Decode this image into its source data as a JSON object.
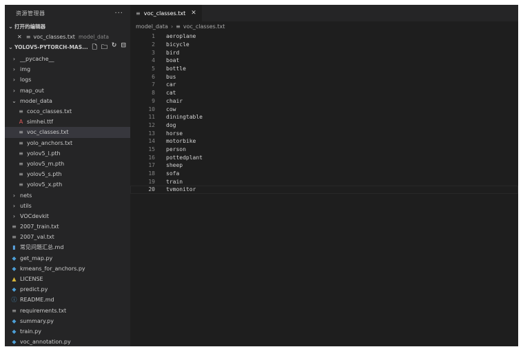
{
  "sidebar": {
    "title": "资源管理器",
    "more": "···",
    "open_editors": {
      "title": "打开的编辑器",
      "items": [
        {
          "name": "voc_classes.txt",
          "description": "model_data"
        }
      ]
    },
    "project": {
      "title": "YOLOV5-PYTORCH-MAS..."
    },
    "tree": [
      {
        "label": "__pycache__",
        "kind": "folder",
        "depth": 0,
        "expanded": false
      },
      {
        "label": "img",
        "kind": "folder",
        "depth": 0,
        "expanded": false
      },
      {
        "label": "logs",
        "kind": "folder",
        "depth": 0,
        "expanded": false
      },
      {
        "label": "map_out",
        "kind": "folder",
        "depth": 0,
        "expanded": false
      },
      {
        "label": "model_data",
        "kind": "folder",
        "depth": 0,
        "expanded": true
      },
      {
        "label": "coco_classes.txt",
        "kind": "txt",
        "depth": 1
      },
      {
        "label": "simhei.ttf",
        "kind": "ttf",
        "depth": 1
      },
      {
        "label": "voc_classes.txt",
        "kind": "txt",
        "depth": 1,
        "selected": true
      },
      {
        "label": "yolo_anchors.txt",
        "kind": "txt",
        "depth": 1
      },
      {
        "label": "yolov5_l.pth",
        "kind": "txt",
        "depth": 1
      },
      {
        "label": "yolov5_m.pth",
        "kind": "txt",
        "depth": 1
      },
      {
        "label": "yolov5_s.pth",
        "kind": "txt",
        "depth": 1
      },
      {
        "label": "yolov5_x.pth",
        "kind": "txt",
        "depth": 1
      },
      {
        "label": "nets",
        "kind": "folder",
        "depth": 0,
        "expanded": false
      },
      {
        "label": "utils",
        "kind": "folder",
        "depth": 0,
        "expanded": false
      },
      {
        "label": "VOCdevkit",
        "kind": "folder",
        "depth": 0,
        "expanded": false
      },
      {
        "label": "2007_train.txt",
        "kind": "txt",
        "depth": 0
      },
      {
        "label": "2007_val.txt",
        "kind": "txt",
        "depth": 0
      },
      {
        "label": "常见问题汇总.md",
        "kind": "md",
        "depth": 0
      },
      {
        "label": "get_map.py",
        "kind": "py",
        "depth": 0
      },
      {
        "label": "kmeans_for_anchors.py",
        "kind": "py",
        "depth": 0
      },
      {
        "label": "LICENSE",
        "kind": "lic",
        "depth": 0
      },
      {
        "label": "predict.py",
        "kind": "py",
        "depth": 0
      },
      {
        "label": "README.md",
        "kind": "info",
        "depth": 0
      },
      {
        "label": "requirements.txt",
        "kind": "txt",
        "depth": 0
      },
      {
        "label": "summary.py",
        "kind": "py",
        "depth": 0
      },
      {
        "label": "train.py",
        "kind": "py",
        "depth": 0
      },
      {
        "label": "voc_annotation.py",
        "kind": "py",
        "depth": 0
      }
    ]
  },
  "editor": {
    "tab": {
      "label": "voc_classes.txt",
      "close": "✕"
    },
    "breadcrumb": {
      "folder": "model_data",
      "separator": "›",
      "file": "voc_classes.txt"
    },
    "lines": [
      "aeroplane",
      "bicycle",
      "bird",
      "boat",
      "bottle",
      "bus",
      "car",
      "cat",
      "chair",
      "cow",
      "diningtable",
      "dog",
      "horse",
      "motorbike",
      "person",
      "pottedplant",
      "sheep",
      "sofa",
      "train",
      "tvmonitor"
    ],
    "active_line": 20
  },
  "icons": {
    "txt": "≡",
    "ttf": "A",
    "py": "◆",
    "md": "▮",
    "lic": "▲",
    "info": "ⓘ",
    "chevron_right": "›",
    "chevron_down": "⌄",
    "close": "✕"
  },
  "colors": {
    "background": "#1e1e1e",
    "sidebar": "#252526",
    "selection": "#37373d",
    "python_icon": "#4d9fd6",
    "font_icon": "#e05b5b",
    "license_icon": "#d8b63a"
  }
}
